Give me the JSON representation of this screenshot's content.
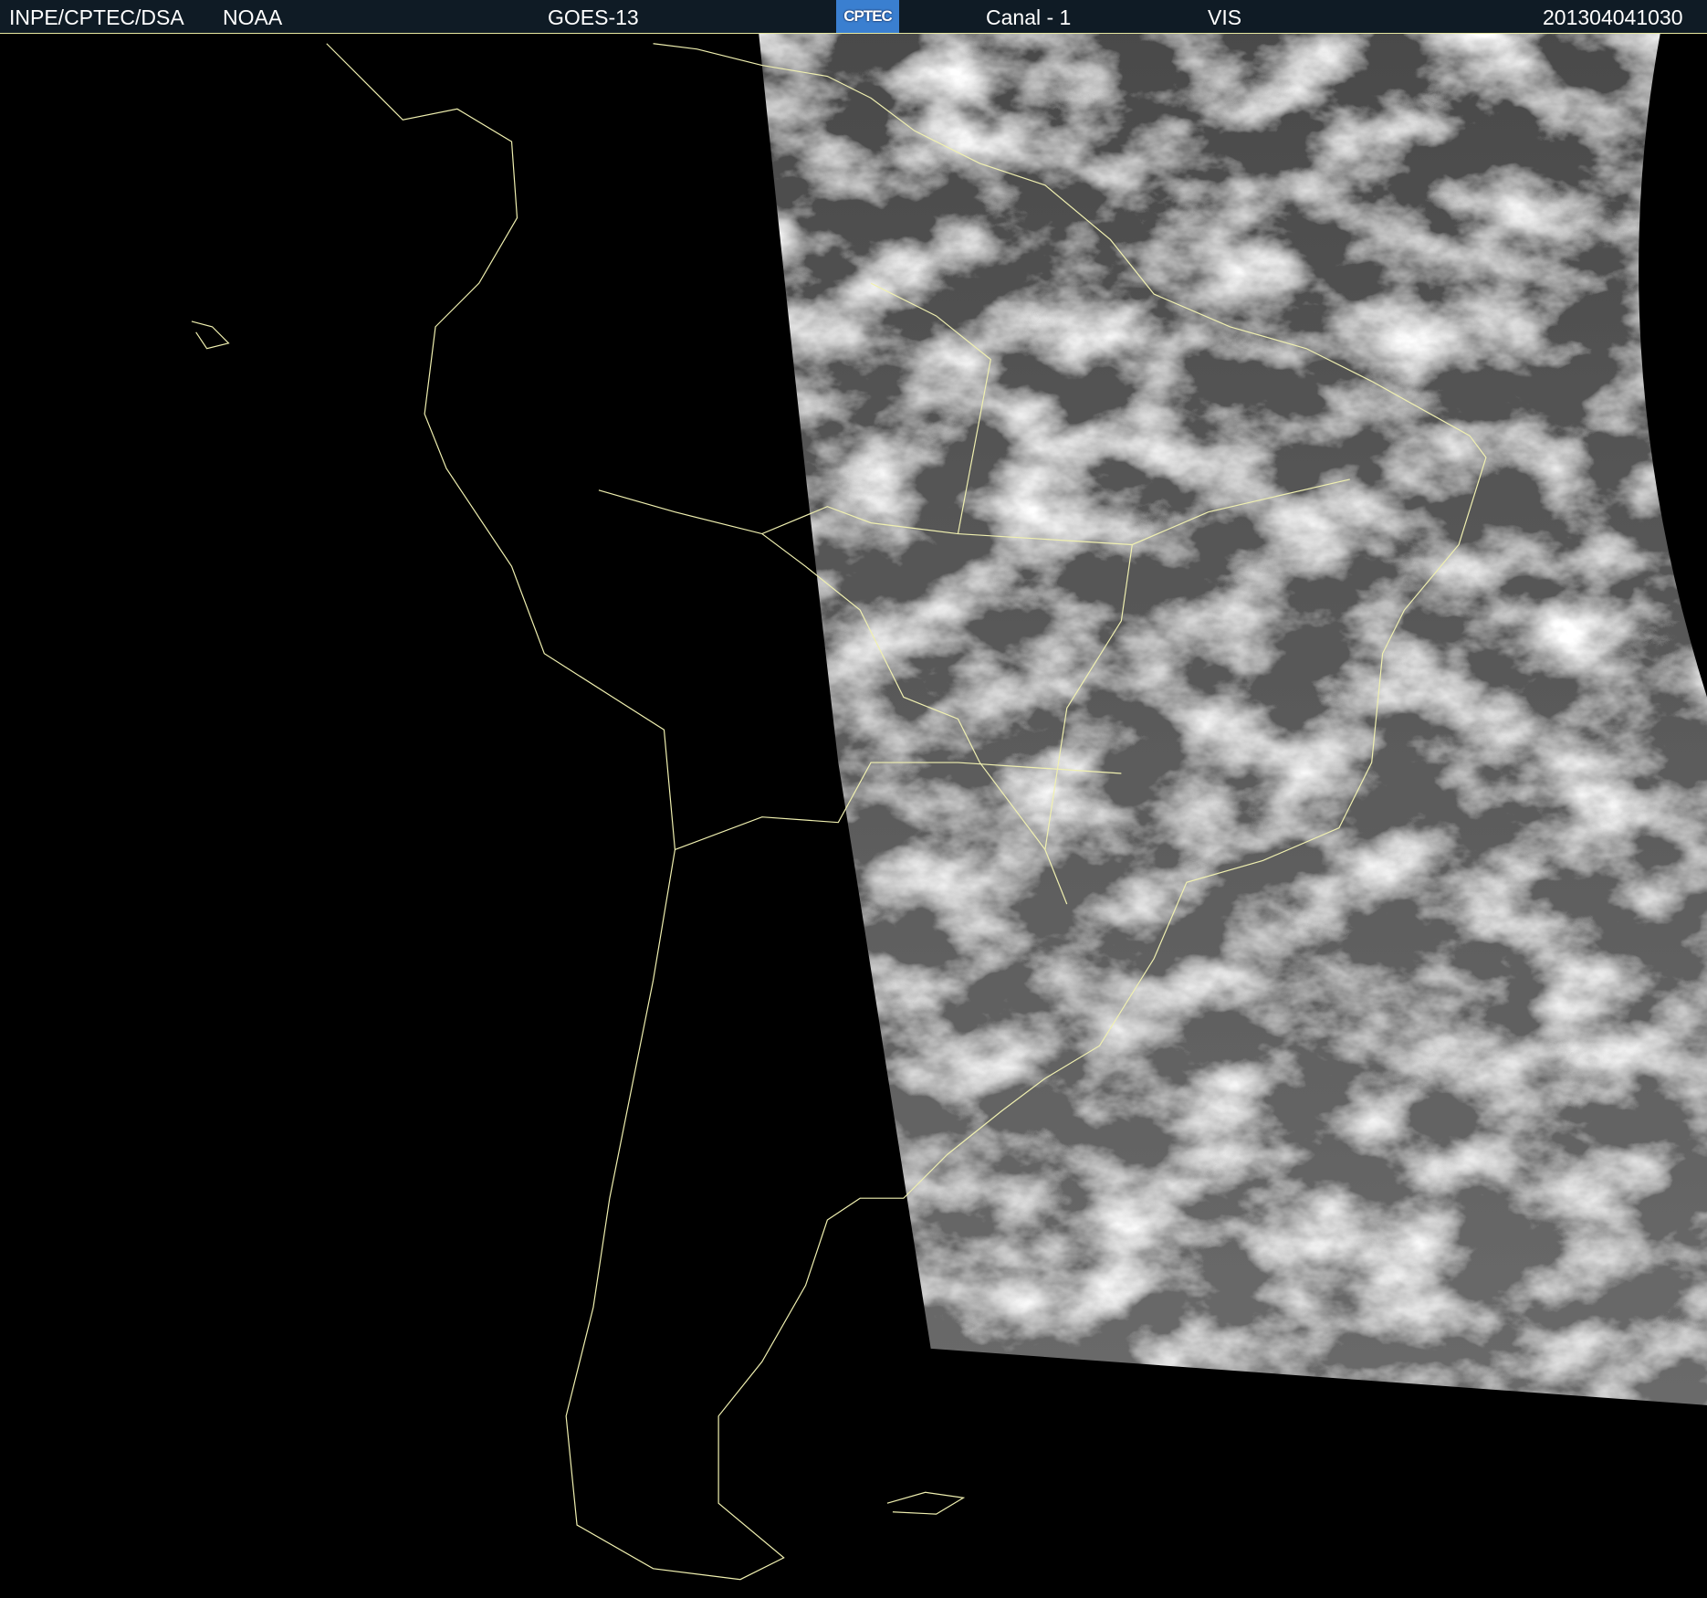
{
  "header": {
    "agency": "INPE/CPTEC/DSA",
    "source": "NOAA",
    "satellite": "GOES-13",
    "logo_text": "CPTEC",
    "channel": "Canal - 1",
    "band": "VIS",
    "timestamp": "201304041030"
  },
  "colors": {
    "header_bg": "#0f1b25",
    "border": "#e8e8a0",
    "coastline": "#f0f0b0",
    "logo_bg": "#3a7fd0"
  }
}
